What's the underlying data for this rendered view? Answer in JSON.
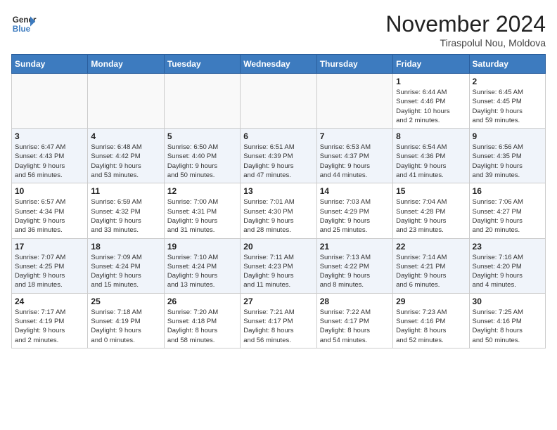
{
  "header": {
    "logo_line1": "General",
    "logo_line2": "Blue",
    "month": "November 2024",
    "location": "Tiraspolul Nou, Moldova"
  },
  "weekdays": [
    "Sunday",
    "Monday",
    "Tuesday",
    "Wednesday",
    "Thursday",
    "Friday",
    "Saturday"
  ],
  "weeks": [
    [
      {
        "day": "",
        "content": ""
      },
      {
        "day": "",
        "content": ""
      },
      {
        "day": "",
        "content": ""
      },
      {
        "day": "",
        "content": ""
      },
      {
        "day": "",
        "content": ""
      },
      {
        "day": "1",
        "content": "Sunrise: 6:44 AM\nSunset: 4:46 PM\nDaylight: 10 hours\nand 2 minutes."
      },
      {
        "day": "2",
        "content": "Sunrise: 6:45 AM\nSunset: 4:45 PM\nDaylight: 9 hours\nand 59 minutes."
      }
    ],
    [
      {
        "day": "3",
        "content": "Sunrise: 6:47 AM\nSunset: 4:43 PM\nDaylight: 9 hours\nand 56 minutes."
      },
      {
        "day": "4",
        "content": "Sunrise: 6:48 AM\nSunset: 4:42 PM\nDaylight: 9 hours\nand 53 minutes."
      },
      {
        "day": "5",
        "content": "Sunrise: 6:50 AM\nSunset: 4:40 PM\nDaylight: 9 hours\nand 50 minutes."
      },
      {
        "day": "6",
        "content": "Sunrise: 6:51 AM\nSunset: 4:39 PM\nDaylight: 9 hours\nand 47 minutes."
      },
      {
        "day": "7",
        "content": "Sunrise: 6:53 AM\nSunset: 4:37 PM\nDaylight: 9 hours\nand 44 minutes."
      },
      {
        "day": "8",
        "content": "Sunrise: 6:54 AM\nSunset: 4:36 PM\nDaylight: 9 hours\nand 41 minutes."
      },
      {
        "day": "9",
        "content": "Sunrise: 6:56 AM\nSunset: 4:35 PM\nDaylight: 9 hours\nand 39 minutes."
      }
    ],
    [
      {
        "day": "10",
        "content": "Sunrise: 6:57 AM\nSunset: 4:34 PM\nDaylight: 9 hours\nand 36 minutes."
      },
      {
        "day": "11",
        "content": "Sunrise: 6:59 AM\nSunset: 4:32 PM\nDaylight: 9 hours\nand 33 minutes."
      },
      {
        "day": "12",
        "content": "Sunrise: 7:00 AM\nSunset: 4:31 PM\nDaylight: 9 hours\nand 31 minutes."
      },
      {
        "day": "13",
        "content": "Sunrise: 7:01 AM\nSunset: 4:30 PM\nDaylight: 9 hours\nand 28 minutes."
      },
      {
        "day": "14",
        "content": "Sunrise: 7:03 AM\nSunset: 4:29 PM\nDaylight: 9 hours\nand 25 minutes."
      },
      {
        "day": "15",
        "content": "Sunrise: 7:04 AM\nSunset: 4:28 PM\nDaylight: 9 hours\nand 23 minutes."
      },
      {
        "day": "16",
        "content": "Sunrise: 7:06 AM\nSunset: 4:27 PM\nDaylight: 9 hours\nand 20 minutes."
      }
    ],
    [
      {
        "day": "17",
        "content": "Sunrise: 7:07 AM\nSunset: 4:25 PM\nDaylight: 9 hours\nand 18 minutes."
      },
      {
        "day": "18",
        "content": "Sunrise: 7:09 AM\nSunset: 4:24 PM\nDaylight: 9 hours\nand 15 minutes."
      },
      {
        "day": "19",
        "content": "Sunrise: 7:10 AM\nSunset: 4:24 PM\nDaylight: 9 hours\nand 13 minutes."
      },
      {
        "day": "20",
        "content": "Sunrise: 7:11 AM\nSunset: 4:23 PM\nDaylight: 9 hours\nand 11 minutes."
      },
      {
        "day": "21",
        "content": "Sunrise: 7:13 AM\nSunset: 4:22 PM\nDaylight: 9 hours\nand 8 minutes."
      },
      {
        "day": "22",
        "content": "Sunrise: 7:14 AM\nSunset: 4:21 PM\nDaylight: 9 hours\nand 6 minutes."
      },
      {
        "day": "23",
        "content": "Sunrise: 7:16 AM\nSunset: 4:20 PM\nDaylight: 9 hours\nand 4 minutes."
      }
    ],
    [
      {
        "day": "24",
        "content": "Sunrise: 7:17 AM\nSunset: 4:19 PM\nDaylight: 9 hours\nand 2 minutes."
      },
      {
        "day": "25",
        "content": "Sunrise: 7:18 AM\nSunset: 4:19 PM\nDaylight: 9 hours\nand 0 minutes."
      },
      {
        "day": "26",
        "content": "Sunrise: 7:20 AM\nSunset: 4:18 PM\nDaylight: 8 hours\nand 58 minutes."
      },
      {
        "day": "27",
        "content": "Sunrise: 7:21 AM\nSunset: 4:17 PM\nDaylight: 8 hours\nand 56 minutes."
      },
      {
        "day": "28",
        "content": "Sunrise: 7:22 AM\nSunset: 4:17 PM\nDaylight: 8 hours\nand 54 minutes."
      },
      {
        "day": "29",
        "content": "Sunrise: 7:23 AM\nSunset: 4:16 PM\nDaylight: 8 hours\nand 52 minutes."
      },
      {
        "day": "30",
        "content": "Sunrise: 7:25 AM\nSunset: 4:16 PM\nDaylight: 8 hours\nand 50 minutes."
      }
    ]
  ]
}
